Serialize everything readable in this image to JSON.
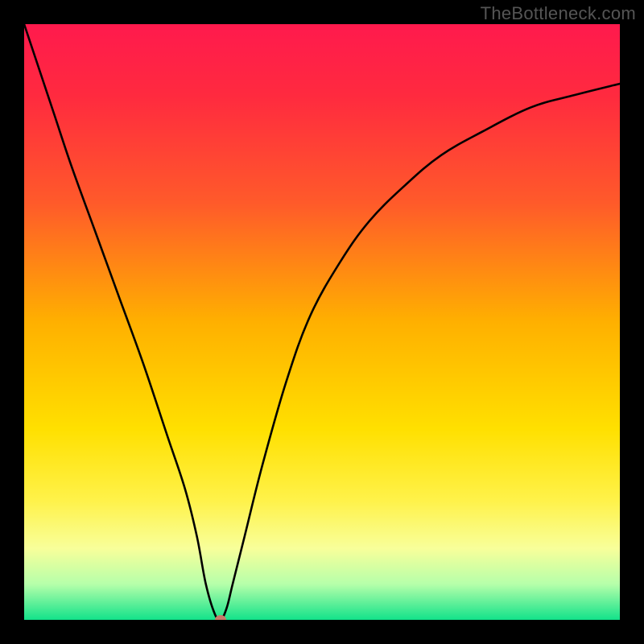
{
  "watermark": "TheBottleneck.com",
  "colors": {
    "frame": "#000000",
    "curve": "#000000",
    "marker": "#c77a6a",
    "gradient_stops": [
      {
        "offset": 0.0,
        "color": "#ff1a4d"
      },
      {
        "offset": 0.12,
        "color": "#ff2a3f"
      },
      {
        "offset": 0.3,
        "color": "#ff5a2a"
      },
      {
        "offset": 0.5,
        "color": "#ffb000"
      },
      {
        "offset": 0.68,
        "color": "#ffe000"
      },
      {
        "offset": 0.8,
        "color": "#fff24a"
      },
      {
        "offset": 0.88,
        "color": "#f8ff9a"
      },
      {
        "offset": 0.94,
        "color": "#b6ffaa"
      },
      {
        "offset": 1.0,
        "color": "#12e28a"
      }
    ]
  },
  "chart_data": {
    "type": "line",
    "title": "",
    "xlabel": "",
    "ylabel": "",
    "xlim": [
      0,
      100
    ],
    "ylim": [
      0,
      100
    ],
    "grid": false,
    "legend": false,
    "series": [
      {
        "name": "bottleneck-curve",
        "x": [
          0,
          2,
          5,
          8,
          12,
          16,
          20,
          24,
          27,
          29,
          30.5,
          32,
          33,
          34,
          35,
          37,
          40,
          44,
          48,
          53,
          58,
          64,
          70,
          77,
          85,
          92,
          100
        ],
        "y": [
          100,
          94,
          85,
          76,
          65,
          54,
          43,
          31,
          22,
          14,
          6,
          1,
          0,
          2,
          6,
          14,
          26,
          40,
          51,
          60,
          67,
          73,
          78,
          82,
          86,
          88,
          90
        ]
      }
    ],
    "marker": {
      "x": 33,
      "y": 0
    },
    "flat_bottom_x_range": [
      31.2,
      33.6
    ]
  }
}
